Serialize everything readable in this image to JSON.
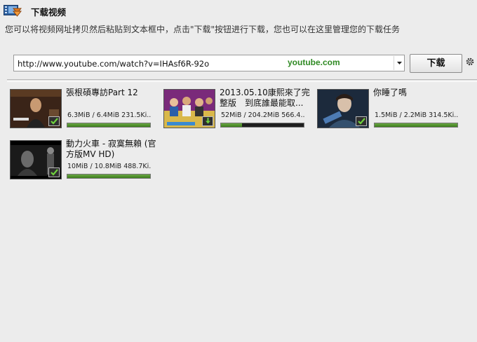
{
  "header": {
    "title": "下载视频",
    "subtitle": "您可以将视频网址拷贝然后粘贴到文本框中，点击\"下载\"按钮进行下载，您也可以在这里管理您的下载任务",
    "icon": "video-download-icon"
  },
  "url_bar": {
    "value": "http://www.youtube.com/watch?v=IHAsf6R-92o",
    "site_label": "youtube.com",
    "download_label": "下载"
  },
  "colors": {
    "progress_fill": "#4a8c28",
    "site_label": "#2f8a23"
  },
  "videos": [
    {
      "title": "張根碩專訪Part 12",
      "size": "6.3MiB / 6.4MiB 231.5Ki...",
      "progress": 1.0,
      "status": "completed"
    },
    {
      "title": "2013.05.10康熙來了完整版　到底誰最能取...",
      "size": "52MiB / 204.2MiB 566.4...",
      "progress": 0.25,
      "status": "downloading"
    },
    {
      "title": "你睡了嗎",
      "size": "1.5MiB / 2.2MiB 314.5Ki...",
      "progress": 1.0,
      "status": "completed"
    },
    {
      "title": "動力火車 - 寂寞無賴 (官方版MV HD)",
      "size": "10MiB / 10.8MiB 488.7Ki...",
      "progress": 1.0,
      "status": "completed"
    }
  ]
}
